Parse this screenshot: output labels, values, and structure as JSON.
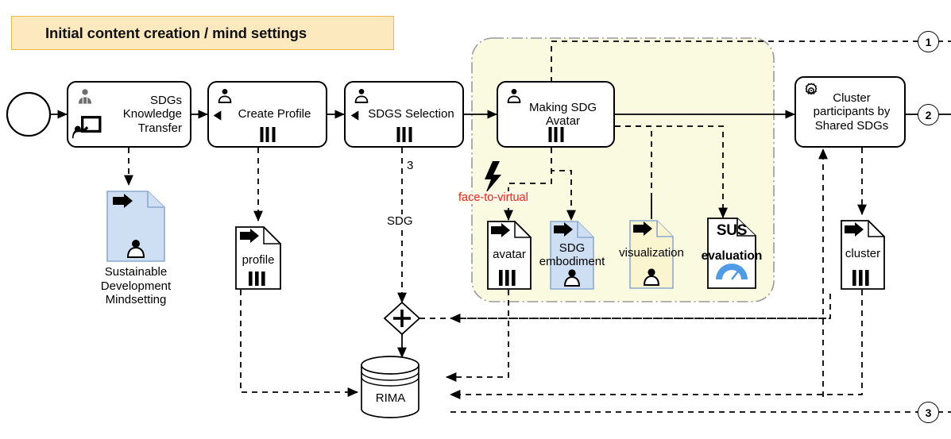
{
  "diagram": {
    "title": "BPMN process diagram",
    "banner": {
      "label": "Initial content creation / mind settings"
    },
    "colors": {
      "banner_fill": "#FCE9BE",
      "banner_border": "#E6B94B",
      "group_fill": "#FAFAE0",
      "group_border": "#999999",
      "doc_blue_fill": "#CFDFF3",
      "doc_blue_border": "#8CA9CE",
      "doc_yellow_fill": "#FAF5CE",
      "doc_yellow_border": "#8CA9CE",
      "accent_red": "#FF1A1A",
      "gauge_blue": "#4E9BE6",
      "line": "#000000"
    },
    "start_event": {
      "name": "start-event"
    },
    "tasks": [
      {
        "id": "sdgs_knowledge_transfer",
        "label": "SDGs\nKnowledge\nTransfer",
        "icon": "user-icon",
        "sub_icon": "presentation-icon",
        "markers": 0,
        "align": "right"
      },
      {
        "id": "create_profile",
        "label": "Create Profile",
        "icon": "user-icon",
        "sub_icon": "play-left-icon",
        "markers": 3,
        "align": "center"
      },
      {
        "id": "sdgs_selection",
        "label": "SDGS Selection",
        "icon": "user-icon",
        "sub_icon": "play-left-icon",
        "markers": 3,
        "align": "center"
      },
      {
        "id": "making_sdg_avatar",
        "label": "Making SDG\nAvatar",
        "icon": "user-icon",
        "markers": 3,
        "align": "center"
      },
      {
        "id": "cluster_participants",
        "label": "Cluster\nparticipants by\nShared SDGs",
        "icon": "gear-icon",
        "markers": 0,
        "align": "center"
      }
    ],
    "artifacts": [
      {
        "id": "sustainable_dev_mindsetting",
        "text": "",
        "caption": "Sustainable\nDevelopment\nMindsetting",
        "style": "blue",
        "has_user": true,
        "has_markers": false
      },
      {
        "id": "profile",
        "text": "profile",
        "caption": "",
        "style": "white",
        "has_user": false,
        "has_markers": true
      },
      {
        "id": "avatar",
        "text": "avatar",
        "caption": "",
        "style": "white",
        "has_user": false,
        "has_markers": true
      },
      {
        "id": "sdg_embodiment",
        "text": "SDG\nembodiment",
        "caption": "",
        "style": "blue",
        "has_user": true,
        "has_markers": false
      },
      {
        "id": "visualization",
        "text": "visualization",
        "caption": "",
        "style": "yellow",
        "has_user": true,
        "has_markers": false
      },
      {
        "id": "sus_evaluation",
        "text_top": "SUS",
        "text_mid": "evaluation",
        "caption": "",
        "style": "white-gauge",
        "has_user": false,
        "has_markers": false
      },
      {
        "id": "cluster",
        "text": "cluster",
        "caption": "",
        "style": "white",
        "has_user": false,
        "has_markers": true
      }
    ],
    "datastore": {
      "label": "RIMA"
    },
    "gateway": {
      "type": "parallel",
      "symbol": "+"
    },
    "event_marker": {
      "type": "intermediate-conditional",
      "symbol": "lightning-bolt-icon"
    },
    "flow_labels": [
      {
        "id": "label-3",
        "text": "3"
      },
      {
        "id": "label-sdg",
        "text": "SDG"
      },
      {
        "id": "label-face-to-virtual",
        "text": "face-to-virtual"
      }
    ],
    "link_events": [
      {
        "id": "link-1",
        "label": "1"
      },
      {
        "id": "link-2",
        "label": "2"
      },
      {
        "id": "link-3",
        "label": "3"
      }
    ]
  }
}
